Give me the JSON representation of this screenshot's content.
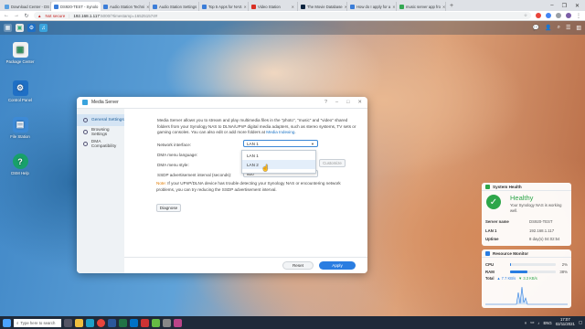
{
  "browser": {
    "tabs": [
      {
        "label": "Download Center - DS",
        "color": "#5aa0e0"
      },
      {
        "label": "DS920-TEST - Synolo",
        "color": "#3b7dd8",
        "active": true
      },
      {
        "label": "Audio Station Techni",
        "color": "#3b7dd8"
      },
      {
        "label": "Audio Station Settings",
        "color": "#3b7dd8"
      },
      {
        "label": "Top 5 Apps for NAS",
        "color": "#3b7dd8"
      },
      {
        "label": "Video Station",
        "color": "#d93025"
      },
      {
        "label": "The Movie Database",
        "color": "#0d253f"
      },
      {
        "label": "How do I apply for a",
        "color": "#3b7dd8"
      },
      {
        "label": "music server app fro",
        "color": "#34a853"
      }
    ],
    "new_tab": "+",
    "not_secure": "Not secure",
    "url": "192.168.1.117",
    "url_path": ":5000/?timestamp=165251574#",
    "win_min": "–",
    "win_max": "❐",
    "win_close": "✕"
  },
  "desktop": {
    "icons": [
      {
        "label": "Package Center",
        "glyph": "▣",
        "color": "#f0f0f0"
      },
      {
        "label": "Control Panel",
        "glyph": "⚙",
        "color": "#1f6fc5"
      },
      {
        "label": "File Station",
        "glyph": "▤",
        "color": "#3d8ad6"
      },
      {
        "label": "DSM Help",
        "glyph": "?",
        "color": "#18a06a"
      }
    ]
  },
  "media_server": {
    "title": "Media Server",
    "help": "?",
    "minimize": "–",
    "maximize": "□",
    "close": "✕",
    "sidebar": [
      {
        "label": "General Settings"
      },
      {
        "label": "Browsing Settings"
      },
      {
        "label": "DMA Compatibility"
      }
    ],
    "description": "Media Server allows you to stream and play multimedia files in the \"photo\", \"music\" and \"video\" shared folders from your Synology NAS to DLNA/UPnP digital media adapters, such as stereo systems, TV sets or gaming consoles. You can also edit or add more folders at",
    "description_link": "Media Indexing",
    "description_end": ".",
    "network_interface_label": "Network interface:",
    "network_interface_value": "LAN 1",
    "dma_language_label": "DMA menu language:",
    "dma_style_label": "DMA menu style:",
    "ssdp_label": "SSDP advertisement interval (seconds):",
    "ssdp_value": "920",
    "dropdown_options": [
      "LAN 1",
      "LAN 2"
    ],
    "customize_label": "Customize",
    "note_prefix": "Note:",
    "note_text": "If your UPnP/DLNA device has trouble detecting your Synology NAS or encountering network problems, you can try reducing the SSDP advertisement interval.",
    "diagnose_label": "Diagnose",
    "reset_label": "Reset",
    "apply_label": "Apply"
  },
  "system_health": {
    "title": "System Health",
    "status": "Healthy",
    "status_desc": "Your Synology NAS is working well.",
    "rows": [
      {
        "key": "Server name",
        "value": "DS920-TEST"
      },
      {
        "key": "LAN 1",
        "value": "192.168.1.117"
      },
      {
        "key": "Uptime",
        "value": "8 day(s) 04:02:54"
      }
    ]
  },
  "resource_monitor": {
    "title": "Resource Monitor",
    "cpu_label": "CPU",
    "cpu_pct": "2%",
    "cpu_value": 0.02,
    "ram_label": "RAM",
    "ram_pct": "38%",
    "ram_value": 0.38,
    "total_label": "Total",
    "up": "▲ 7.7 KB/s",
    "down": "▼ 3.3 KB/s"
  },
  "taskbar": {
    "search_placeholder": "Type here to search",
    "time": "17:07",
    "date": "02/11/2021",
    "lang": "ENG"
  }
}
